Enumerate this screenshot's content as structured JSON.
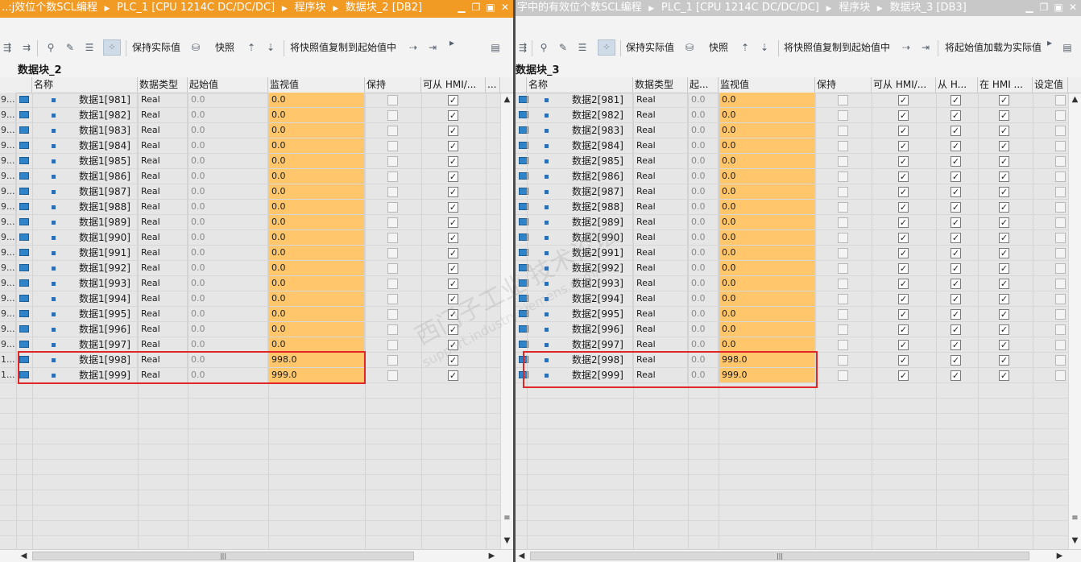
{
  "left": {
    "breadcrumb": [
      "..:j效位个数SCL编程",
      "PLC_1 [CPU 1214C DC/DC/DC]",
      "程序块",
      "数据块_2 [DB2]"
    ],
    "toolbar": {
      "keep_actual": "保持实际值",
      "snapshot": "快照",
      "copy_snapshot": "将快照值复制到起始值中"
    },
    "block_title": "数据块_2",
    "headers": [
      "名称",
      "数据类型",
      "起始值",
      "监视值",
      "保持",
      "可从 HMI/...",
      "..."
    ],
    "rownums": [
      "9...",
      "9...",
      "9...",
      "9...",
      "9...",
      "9...",
      "9...",
      "9...",
      "9...",
      "9...",
      "9...",
      "9...",
      "9...",
      "9...",
      "9...",
      "9...",
      "9...",
      "1...",
      "1..."
    ],
    "rows": [
      {
        "name": "数据1[981]",
        "type": "Real",
        "start": "0.0",
        "monitor": "0.0"
      },
      {
        "name": "数据1[982]",
        "type": "Real",
        "start": "0.0",
        "monitor": "0.0"
      },
      {
        "name": "数据1[983]",
        "type": "Real",
        "start": "0.0",
        "monitor": "0.0"
      },
      {
        "name": "数据1[984]",
        "type": "Real",
        "start": "0.0",
        "monitor": "0.0"
      },
      {
        "name": "数据1[985]",
        "type": "Real",
        "start": "0.0",
        "monitor": "0.0"
      },
      {
        "name": "数据1[986]",
        "type": "Real",
        "start": "0.0",
        "monitor": "0.0"
      },
      {
        "name": "数据1[987]",
        "type": "Real",
        "start": "0.0",
        "monitor": "0.0"
      },
      {
        "name": "数据1[988]",
        "type": "Real",
        "start": "0.0",
        "monitor": "0.0"
      },
      {
        "name": "数据1[989]",
        "type": "Real",
        "start": "0.0",
        "monitor": "0.0"
      },
      {
        "name": "数据1[990]",
        "type": "Real",
        "start": "0.0",
        "monitor": "0.0"
      },
      {
        "name": "数据1[991]",
        "type": "Real",
        "start": "0.0",
        "monitor": "0.0"
      },
      {
        "name": "数据1[992]",
        "type": "Real",
        "start": "0.0",
        "monitor": "0.0"
      },
      {
        "name": "数据1[993]",
        "type": "Real",
        "start": "0.0",
        "monitor": "0.0"
      },
      {
        "name": "数据1[994]",
        "type": "Real",
        "start": "0.0",
        "monitor": "0.0"
      },
      {
        "name": "数据1[995]",
        "type": "Real",
        "start": "0.0",
        "monitor": "0.0"
      },
      {
        "name": "数据1[996]",
        "type": "Real",
        "start": "0.0",
        "monitor": "0.0"
      },
      {
        "name": "数据1[997]",
        "type": "Real",
        "start": "0.0",
        "monitor": "0.0"
      },
      {
        "name": "数据1[998]",
        "type": "Real",
        "start": "0.0",
        "monitor": "998.0"
      },
      {
        "name": "数据1[999]",
        "type": "Real",
        "start": "0.0",
        "monitor": "999.0"
      }
    ]
  },
  "right": {
    "breadcrumb": [
      "字中的有效位个数SCL编程",
      "PLC_1 [CPU 1214C DC/DC/DC]",
      "程序块",
      "数据块_3 [DB3]"
    ],
    "toolbar": {
      "keep_actual": "保持实际值",
      "snapshot": "快照",
      "copy_snapshot": "将快照值复制到起始值中",
      "load_start": "将起始值加载为实际值"
    },
    "block_title": "数据块_3",
    "headers": [
      "名称",
      "数据类型",
      "起...",
      "监视值",
      "保持",
      "可从 HMI/...",
      "从 H...",
      "在 HMI ...",
      "设定值"
    ],
    "rows": [
      {
        "name": "数据2[981]",
        "type": "Real",
        "start": "0.0",
        "monitor": "0.0"
      },
      {
        "name": "数据2[982]",
        "type": "Real",
        "start": "0.0",
        "monitor": "0.0"
      },
      {
        "name": "数据2[983]",
        "type": "Real",
        "start": "0.0",
        "monitor": "0.0"
      },
      {
        "name": "数据2[984]",
        "type": "Real",
        "start": "0.0",
        "monitor": "0.0"
      },
      {
        "name": "数据2[985]",
        "type": "Real",
        "start": "0.0",
        "monitor": "0.0"
      },
      {
        "name": "数据2[986]",
        "type": "Real",
        "start": "0.0",
        "monitor": "0.0"
      },
      {
        "name": "数据2[987]",
        "type": "Real",
        "start": "0.0",
        "monitor": "0.0"
      },
      {
        "name": "数据2[988]",
        "type": "Real",
        "start": "0.0",
        "monitor": "0.0"
      },
      {
        "name": "数据2[989]",
        "type": "Real",
        "start": "0.0",
        "monitor": "0.0"
      },
      {
        "name": "数据2[990]",
        "type": "Real",
        "start": "0.0",
        "monitor": "0.0"
      },
      {
        "name": "数据2[991]",
        "type": "Real",
        "start": "0.0",
        "monitor": "0.0"
      },
      {
        "name": "数据2[992]",
        "type": "Real",
        "start": "0.0",
        "monitor": "0.0"
      },
      {
        "name": "数据2[993]",
        "type": "Real",
        "start": "0.0",
        "monitor": "0.0"
      },
      {
        "name": "数据2[994]",
        "type": "Real",
        "start": "0.0",
        "monitor": "0.0"
      },
      {
        "name": "数据2[995]",
        "type": "Real",
        "start": "0.0",
        "monitor": "0.0"
      },
      {
        "name": "数据2[996]",
        "type": "Real",
        "start": "0.0",
        "monitor": "0.0"
      },
      {
        "name": "数据2[997]",
        "type": "Real",
        "start": "0.0",
        "monitor": "0.0"
      },
      {
        "name": "数据2[998]",
        "type": "Real",
        "start": "0.0",
        "monitor": "998.0"
      },
      {
        "name": "数据2[999]",
        "type": "Real",
        "start": "0.0",
        "monitor": "999.0"
      }
    ]
  },
  "watermark": {
    "line1": "西门子工业 技术论坛",
    "line2": "support.industry.siemens.com/cs"
  },
  "colors": {
    "active_title": "#f19a24",
    "monitor_cell": "#ffc66b",
    "highlight_box": "#e02626"
  }
}
